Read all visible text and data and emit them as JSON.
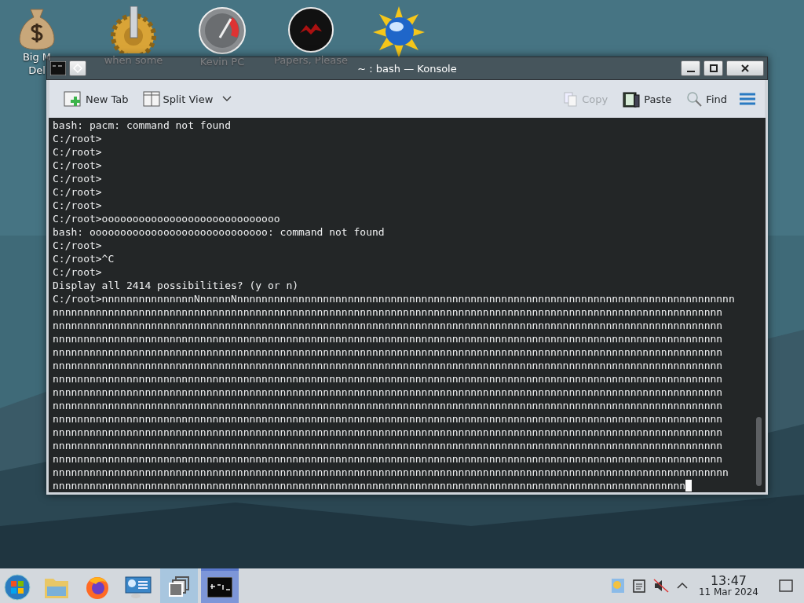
{
  "desktop_icons": [
    {
      "kind": "money",
      "label_lines": [
        "Big M",
        "Del"
      ]
    },
    {
      "kind": "gear",
      "label_lines": [
        "when some"
      ]
    },
    {
      "kind": "gauge",
      "label_lines": [
        "Kevin PC"
      ]
    },
    {
      "kind": "disc",
      "label_lines": [
        "Papers, Please"
      ]
    },
    {
      "kind": "globe"
    }
  ],
  "window": {
    "title": "~ : bash — Konsole",
    "toolbar_left": [
      {
        "kind": "newtab",
        "label": "New Tab",
        "disabled": false
      },
      {
        "kind": "split",
        "label": "Split View",
        "disabled": false
      }
    ],
    "toolbar_right": [
      {
        "kind": "copy",
        "label": "Copy",
        "disabled": true
      },
      {
        "kind": "paste",
        "label": "Paste",
        "disabled": false
      },
      {
        "kind": "find",
        "label": "Find",
        "disabled": false
      }
    ],
    "terminal": {
      "lines": [
        "bash: pacm: command not found",
        "C:/root>",
        "C:/root>",
        "C:/root>",
        "C:/root>",
        "C:/root>",
        "C:/root>",
        "C:/root>ooooooooooooooooooooooooooooo",
        "bash: ooooooooooooooooooooooooooooo: command not found",
        "C:/root>",
        "C:/root>^C",
        "C:/root>",
        "Display all 2414 possibilities? (y or n)",
        "C:/root>nnnnnnnnnnnnnnnNnnnnnNnnnnnnnnnnnnnnnnnnnnnnnnnnnnnnnnnnnnnnnnnnnnnnnnnnnnnnnnnnnnnnnnnnnnnnnnnnnnnnnnn",
        "nnnnnnnnnnnnnnnnnnnnnnnnnnnnnnnnnnnnnnnnnnnnnnnnnnnnnnnnnnnnnnnnnnnnnnnnnnnnnnnnnnnnnnnnnnnnnnnnnnnnnnnnnnnnn",
        "nnnnnnnnnnnnnnnnnnnnnnnnnnnnnnnnnnnnnnnnnnnnnnnnnnnnnnnnnnnnnnnnnnnnnnnnnnnnnnnnnnnnnnnnnnnnnnnnnnnnnnnnnnnnn",
        "nnnnnnnnnnnnnnnnnnnnnnnnnnnnnnnnnnnnnnnnnnnnnnnnnnnnnnnnnnnnnnnnnnnnnnnnnnnnnnnnnnnnnnnnnnnnnnnnnnnnnnnnnnnnn",
        "nnnnnnnnnnnnnnnnnnnnnnnnnnnnnnnnnnnnnnnnnnnnnnnnnnnnnnnnnnnnnnnnnnnnnnnnnnnnnnnnnnnnnnnnnnnnnnnnnnnnnnnnnnnnn",
        "nnnnnnnnnnnnnnnnnnnnnnnnnnnnnnnnnnnnnnnnnnnnnnnnnnnnnnnnnnnnnnnnnnnnnnnnnnnnnnnnnnnnnnnnnnnnnnnnnnnnnnnnnnnnn",
        "nnnnnnnnnnnnnnnnnnnnnnnnnnnnnnnnnnnnnnnnnnnnnnnnnnnnnnnnnnnnnnnnnnnnnnnnnnnnnnnnnnnnnnnnnnnnnnnnnnnnnnnnnnnnn",
        "nnnnnnnnnnnnnnnnnnnnnnnnnnnnnnnnnnnnnnnnnnnnnnnnnnnnnnnnnnnnnnnnnnnnnnnnnnnnnnnnnnnnnnnnnnnnnnnnnnnnnnnnnnnnn",
        "nnnnnnnnnnnnnnnnnnnnnnnnnnnnnnnnnnnnnnnnnnnnnnnnnnnnnnnnnnnnnnnnnnnnnnnnnnnnnnnnnnnnnnnnnnnnnnnnnnnnnnnnnnnnn",
        "nnnnnnnnnnnnnnnnnnnnnnnnnnnnnnnnnnnnnnnnnnnnnnnnnnnnnnnnnnnnnnnnnnnnnnnnnnnnnnnnnnnnnnnnnnnnnnnnnnnnnnnnnnnnn",
        "nnnnnnnnnnnnnnnnnnnnnnnnnnnnnnnnnnnnnnnnnnnnnnnnnnnnnnnnnnnnnnnnnnnnnnnnnnnnnnnnnnnnnnnnnnnnnnnnnnnnnnnnnnnnn",
        "nnnnnnnnnnnnnnnnnnnnnnnnnnnnnnnnnnnnnnnnnnnnnnnnnnnnnnnnnnnnnnnnnnnnnnnnnnnnnnnnnnnnnnnnnnnnnnnnnnnnnnnnnnnnn",
        "nnnnnnnnnnnnnnnnnnnnnnnnnnnnnnnnnnnnnnnnnnnnnnnnnnnnnnnnnnnnnnnnnnnnnnnnnnnnnnnnnnnnnnnnnnnnnnnnnnnnnnnnnnnnn",
        "nnnnnnnnnnnnnnnnnnnnnnnnnnnnnnnnnnnnnnnnnnnnnnnnnnnnnnnnnnnnnnnnnnnnnnnnnnnnnnnnnnnnnnnnnnnnnnnnnnnnnnnnnnnnnn",
        "nnnnnnnnnnnnnnnnnnnnnnnnnnnnnnnnnnnnnnnnnnnnnnnnnnnnnnnnnnnnnnnnnnnnnnnnnnnnnnnnnnnnnnnnnnnnnnnnnnnnnnn"
      ],
      "cursor": true
    }
  },
  "taskbar": {
    "items": [
      {
        "kind": "start",
        "selected": false
      },
      {
        "kind": "folder",
        "selected": false
      },
      {
        "kind": "browser",
        "selected": false
      },
      {
        "kind": "network",
        "selected": false
      },
      {
        "kind": "windows",
        "selected": false
      },
      {
        "kind": "terminal",
        "selected": true
      }
    ],
    "tray": {
      "muted": true,
      "time": "13:47",
      "date": "11 Mar 2024"
    }
  }
}
